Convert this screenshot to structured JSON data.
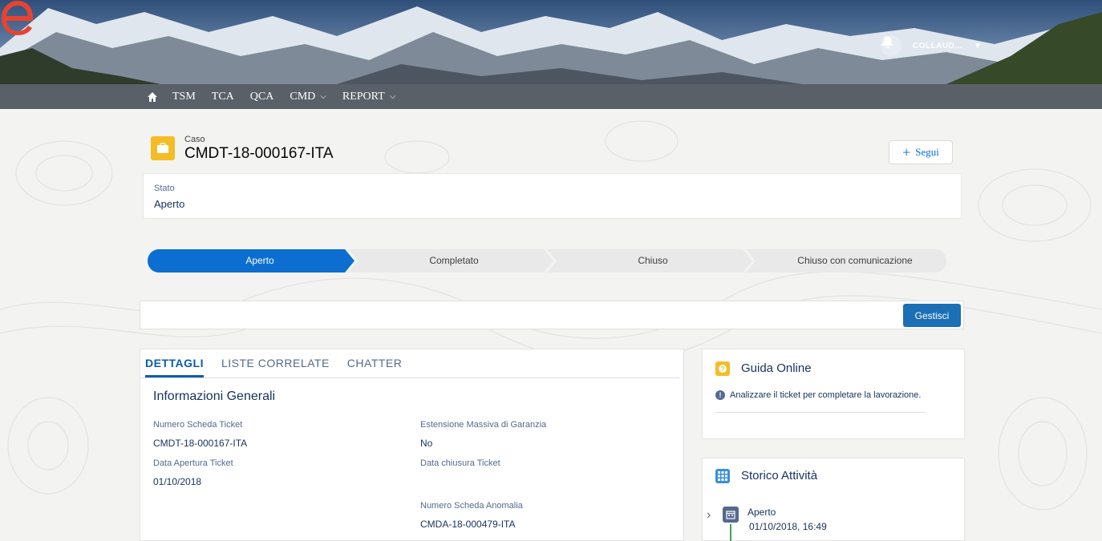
{
  "header": {
    "user_name": "COLLAUD..."
  },
  "nav": {
    "items": [
      {
        "label": "TSM",
        "has_dropdown": false
      },
      {
        "label": "TCA",
        "has_dropdown": false
      },
      {
        "label": "QCA",
        "has_dropdown": false
      },
      {
        "label": "CMD",
        "has_dropdown": true
      },
      {
        "label": "REPORT",
        "has_dropdown": true
      }
    ]
  },
  "record": {
    "type_label": "Caso",
    "number": "CMDT-18-000167-ITA",
    "follow_label": "Segui"
  },
  "status": {
    "label": "Stato",
    "value": "Aperto"
  },
  "path": {
    "steps": [
      "Aperto",
      "Completato",
      "Chiuso",
      "Chiuso con comunicazione"
    ],
    "active_index": 0
  },
  "actions": {
    "manage_label": "Gestisci"
  },
  "details": {
    "tabs": [
      "DETTAGLI",
      "LISTE CORRELATE",
      "CHATTER"
    ],
    "active_tab": 0,
    "section_title": "Informazioni Generali",
    "fields": {
      "ticket_number_label": "Numero Scheda Ticket",
      "ticket_number_value": "CMDT-18-000167-ITA",
      "warranty_label": "Estensione Massiva di Garanzia",
      "warranty_value": "No",
      "open_date_label": "Data Apertura Ticket",
      "open_date_value": "01/10/2018",
      "close_date_label": "Data chiusura Ticket",
      "anomaly_label": "Numero Scheda Anomalia",
      "anomaly_value": "CMDA-18-000479-ITA"
    }
  },
  "guide": {
    "title": "Guida Online",
    "text": "Analizzare il ticket per completare la lavorazione."
  },
  "history": {
    "title": "Storico Attività",
    "entries": [
      {
        "title": "Aperto",
        "date": "01/10/2018, 16:49"
      }
    ]
  },
  "colors": {
    "accent": "#0070d2",
    "path_active": "#0b6ed0",
    "case_icon": "#f4bc25",
    "nav_bg": "#5a6068"
  }
}
